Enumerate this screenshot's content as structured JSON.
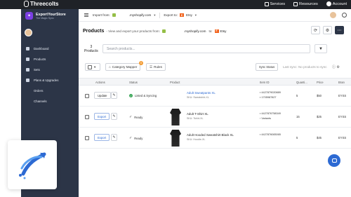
{
  "topbar": {
    "brand": "Threecolts",
    "services": "Services",
    "resources": "Resources",
    "account": "Account"
  },
  "sidebar": {
    "app_name": "ExportYourStore",
    "app_sub": "The Magic Sync",
    "items": [
      {
        "label": "Dashboard",
        "icon": "dashboard-icon"
      },
      {
        "label": "Products",
        "icon": "products-icon"
      },
      {
        "label": "Sets",
        "icon": "sets-icon"
      },
      {
        "label": "Plans & Upgrades",
        "icon": "plans-icon"
      },
      {
        "label": "Orders",
        "icon": ""
      },
      {
        "label": "Channels",
        "icon": ""
      }
    ]
  },
  "header": {
    "import_from_label": "Import from:",
    "import_domain": ".myshopify.com",
    "export_to_label": "Export to:",
    "export_target": "Etsy"
  },
  "products_bar": {
    "title": "Products",
    "description": "- View and export your products from:",
    "from_domain": ".myshopify.com",
    "to_word": "to:",
    "to_target": "Etsy"
  },
  "search": {
    "count": "3",
    "count_label": "Products",
    "placeholder": "Search products..."
  },
  "toolbar": {
    "category_mapper": "Category Mapper",
    "category_badge": "0",
    "rules": "Rules",
    "sync_status": "Sync Status",
    "last_sync": "Last sync: No products to sync"
  },
  "table": {
    "headers": [
      "Actions",
      "Status",
      "Product",
      "Item ID",
      "Quanti...",
      "Price",
      "Bran"
    ],
    "rows": [
      {
        "action": "Update",
        "status": "Listed & Syncing",
        "name": "Adult Sweatpants XL",
        "sku": "SKU: Sweatshirt-XL",
        "id1": "4427879020889",
        "id2": "1705987827",
        "qty": "5",
        "price": "$50",
        "brand": "EYSS"
      },
      {
        "action": "Export",
        "status": "Ready",
        "name": "Adult T-Shirt XL",
        "sku": "SKU: Tshirt-XL",
        "id1": "4427876758349",
        "id2": "Variants",
        "qty": "15",
        "price": "$25",
        "brand": "EYSS"
      },
      {
        "action": "Export",
        "status": "Ready",
        "name": "Adult Hooded Sweatshirt Black XL",
        "sku": "SKU: Hoodie-XL",
        "id1": "4427876083065",
        "id2": "",
        "qty": "5",
        "price": "$45",
        "brand": "EYSS"
      }
    ]
  },
  "colors": {
    "topbar": "#1f2227",
    "sidebar": "#2c3547",
    "accent": "#2d6ad3",
    "shopify": "#95bf47",
    "etsy": "#f1641e",
    "synced": "#3aa657"
  }
}
